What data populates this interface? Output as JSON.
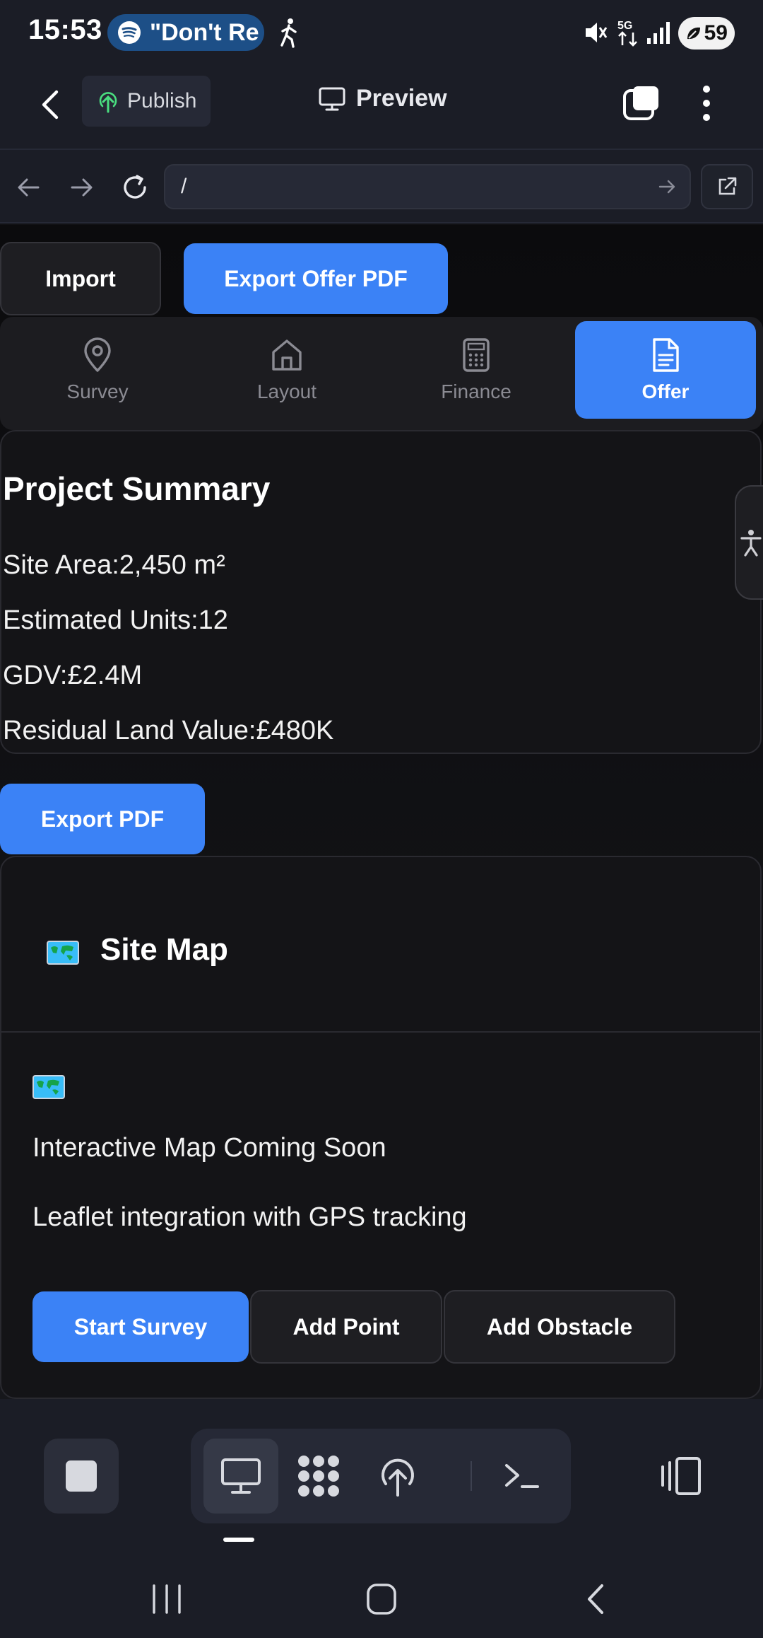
{
  "status_bar": {
    "time": "15:53",
    "media_pill_text": "\"Don't Re",
    "battery": "59",
    "icons": [
      "spotify-icon",
      "walking-icon",
      "mute-icon",
      "5g-icon",
      "signal-icon",
      "battery-icon"
    ]
  },
  "app_header": {
    "publish_label": "Publish",
    "title": "Preview"
  },
  "url_bar": {
    "url": "/"
  },
  "toolbar": {
    "import_label": "Import",
    "export_offer_label": "Export Offer PDF"
  },
  "tabs": [
    {
      "label": "Survey",
      "icon": "map-pin-icon",
      "active": false
    },
    {
      "label": "Layout",
      "icon": "home-icon",
      "active": false
    },
    {
      "label": "Finance",
      "icon": "calculator-icon",
      "active": false
    },
    {
      "label": "Offer",
      "icon": "document-icon",
      "active": true
    }
  ],
  "summary": {
    "title": "Project Summary",
    "rows": [
      {
        "label": "Site Area:",
        "value": "2,450 m²"
      },
      {
        "label": "Estimated Units:",
        "value": "12"
      },
      {
        "label": "GDV:",
        "value": "£2.4M"
      },
      {
        "label": "Residual Land Value:",
        "value": "£480K"
      }
    ]
  },
  "export_pdf_label": "Export PDF",
  "site_map": {
    "title": "Site Map",
    "coming_soon": "Interactive Map Coming Soon",
    "description": "Leaflet integration with GPS tracking",
    "buttons": {
      "start_survey": "Start Survey",
      "add_point": "Add Point",
      "add_obstacle": "Add Obstacle"
    }
  },
  "colors": {
    "accent": "#3b82f6",
    "background": "#111114",
    "card": "#141417",
    "header": "#1b1d26"
  }
}
